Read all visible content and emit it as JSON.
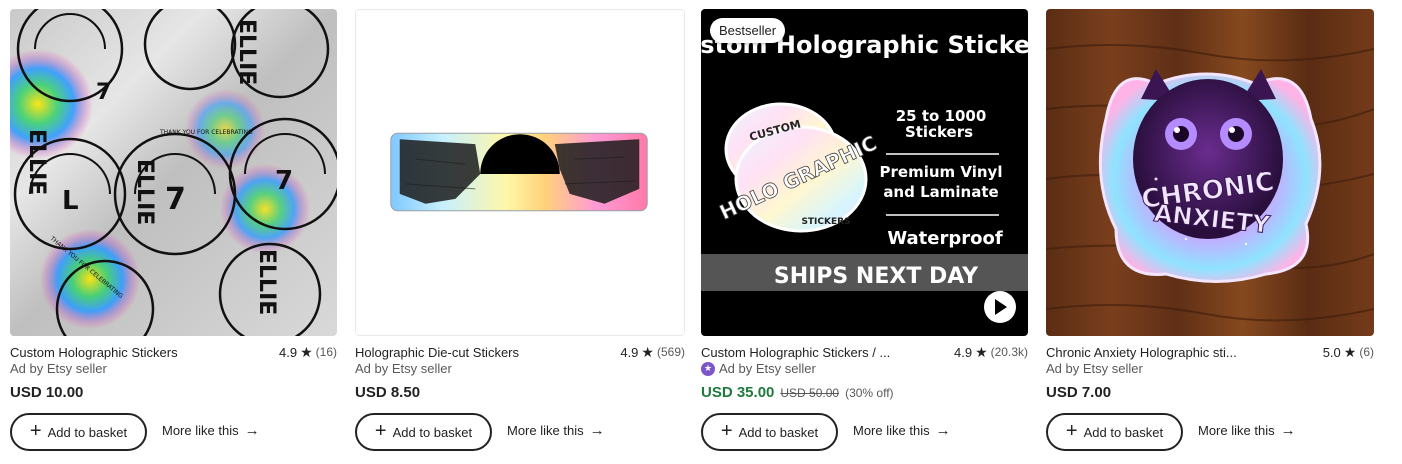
{
  "products": [
    {
      "title": "Custom Holographic Stickers",
      "rating": "4.9",
      "reviews": "(16)",
      "seller": "Ad by Etsy seller",
      "price": "USD 10.00",
      "image": {
        "name": "ellie-holographic-circle-stickers",
        "texts": [
          "ELLIE",
          "7",
          "THANK YOU FOR CELEBRATING"
        ]
      }
    },
    {
      "title": "Holographic Die-cut Stickers",
      "rating": "4.9",
      "reviews": "(569)",
      "seller": "Ad by Etsy seller",
      "price": "USD 8.50",
      "image": {
        "name": "landscape-holographic-strip-sticker"
      }
    },
    {
      "badge": "Bestseller",
      "title": "Custom Holographic Stickers / ...",
      "rating": "4.9",
      "reviews": "(20.3k)",
      "seller": "Ad by Etsy seller",
      "price": "USD 35.00",
      "original_price": "USD 50.00",
      "discount": "(30% off)",
      "image": {
        "name": "custom-holographic-stickers-promo",
        "headline": "Custom Holographic Stickers",
        "line1": "25 to 1000",
        "line2": "Stickers",
        "line3": "Premium Vinyl",
        "line4": "and Laminate",
        "line5": "Waterproof",
        "banner": "SHIPS NEXT DAY",
        "sticker_top": "CUSTOM",
        "sticker_main": "HOLO GRAPHIC",
        "sticker_bottom": "STICKERS"
      }
    },
    {
      "title": "Chronic Anxiety Holographic sti...",
      "rating": "5.0",
      "reviews": "(6)",
      "seller": "Ad by Etsy seller",
      "price": "USD 7.00",
      "image": {
        "name": "chronic-anxiety-cat-sticker",
        "line1": "CHRONIC",
        "line2": "ANXIETY"
      }
    }
  ],
  "actions": {
    "add_to_basket": "Add to basket",
    "more_like_this": "More like this"
  },
  "colors": {
    "sale_price": "#1f7a3d",
    "star_seller": "#7b56c8",
    "text": "#222222",
    "muted": "#595959"
  }
}
